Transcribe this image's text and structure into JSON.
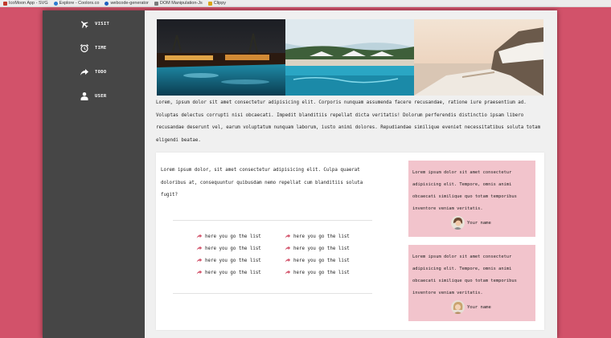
{
  "bookmarks": [
    {
      "label": "IcoMoon App - SVG",
      "icon": "icomoon-favicon",
      "color": "#c0392b"
    },
    {
      "label": "Explore - Coolors.co",
      "icon": "coolors-favicon",
      "color": "#2b7bd1"
    },
    {
      "label": "webcode-generator",
      "icon": "webcode-favicon",
      "color": "#1e5fbf"
    },
    {
      "label": "DOM Manipulation-Js",
      "icon": "dom-favicon",
      "color": "#7a7a7a"
    },
    {
      "label": "Clippy",
      "icon": "clippy-favicon",
      "color": "#d9a514"
    }
  ],
  "sidebar": {
    "items": [
      {
        "label": "VISIT",
        "icon": "airplane-icon"
      },
      {
        "label": "TIME",
        "icon": "alarm-clock-icon"
      },
      {
        "label": "TODO",
        "icon": "share-arrow-icon"
      },
      {
        "label": "USER",
        "icon": "user-icon"
      }
    ]
  },
  "hero": {
    "images": [
      "night-resort-pool-photo",
      "daytime-resort-pool-photo",
      "seaside-cliff-terrace-photo"
    ]
  },
  "description": "Lorem, ipsum dolor sit amet consectetur adipisicing elit. Corporis nunquam assumenda facere recusandae, ratione iure praesentium ad. Voluptas delectus corrupti nisi obcaecati. Impedit blanditiis repellat dicta veritatis! Dolorum perferendis distinctio ipsam libero recusandae deserunt vel, earum voluptatum nunquam laborum, iusto animi dolores. Repudiandae similique eveniet necessitatibus soluta totam eligendi beatae.",
  "content": {
    "text": "Lorem ipsum dolor, sit amet consectetur adipisicing elit. Culpa quaerat doloribus at, consequuntur quibusdam nemo repellat cum blanditiis soluta fugit?",
    "list": [
      "here you go the list",
      "here you go the list",
      "here you go the list",
      "here you go the list",
      "here you go the list",
      "here you go the list",
      "here you go the list",
      "here you go the list"
    ]
  },
  "testimonials": [
    {
      "text": "Lorem ipsum dolor sit amet consectetur adipisicing elit. Tempore, omnis animi obcaecati similique quo totam temporibus inventore veniam veritatis.",
      "name": "Your name"
    },
    {
      "text": "Lorem ipsum dolor sit amet consectetur adipisicing elit. Tempore, omnis animi obcaecati similique quo totam temporibus inventore veniam veritatis.",
      "name": "Your name"
    }
  ],
  "colors": {
    "background": "#d2526a",
    "sidebar": "#464646",
    "accent": "#d2526a",
    "quote_bg": "#f2c4cc"
  }
}
